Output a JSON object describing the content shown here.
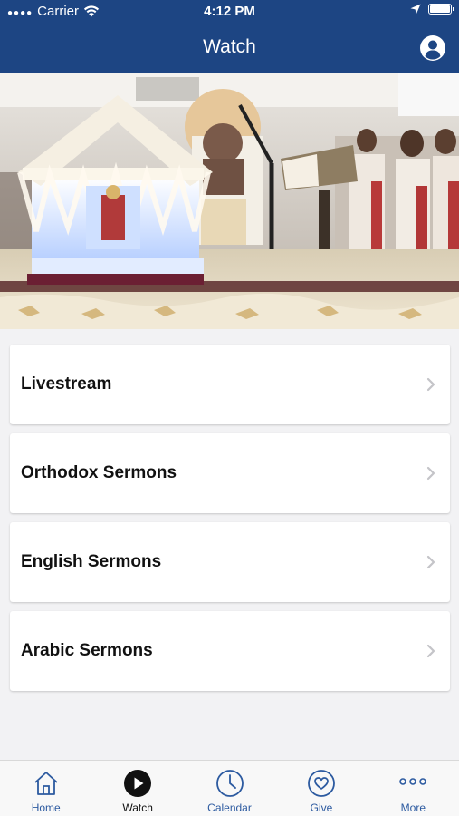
{
  "status_bar": {
    "carrier": "Carrier",
    "time": "4:12 PM"
  },
  "nav": {
    "title": "Watch",
    "profile_icon": "person-circle-icon"
  },
  "hero": {
    "icon": "church-altar-photo"
  },
  "menu": {
    "items": [
      {
        "label": "Livestream"
      },
      {
        "label": "Orthodox Sermons"
      },
      {
        "label": "English Sermons"
      },
      {
        "label": "Arabic Sermons"
      }
    ]
  },
  "tabbar": {
    "items": [
      {
        "label": "Home",
        "icon": "home-icon"
      },
      {
        "label": "Watch",
        "icon": "play-icon",
        "active": true
      },
      {
        "label": "Calendar",
        "icon": "clock-icon"
      },
      {
        "label": "Give",
        "icon": "heart-icon"
      },
      {
        "label": "More",
        "icon": "more-dots-icon"
      }
    ]
  },
  "colors": {
    "header": "#1d4583",
    "accent": "#2c5aa0",
    "background": "#f2f2f4"
  }
}
